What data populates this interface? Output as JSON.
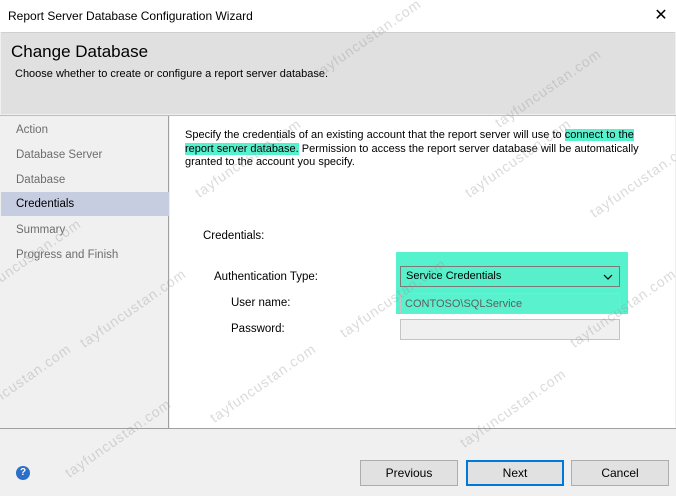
{
  "window": {
    "title": "Report Server Database Configuration Wizard",
    "close_glyph": "✕"
  },
  "header": {
    "title": "Change Database",
    "subtitle": "Choose whether to create or configure a report server database."
  },
  "sidebar": {
    "items": [
      {
        "label": "Action"
      },
      {
        "label": "Database Server"
      },
      {
        "label": "Database"
      },
      {
        "label": "Credentials"
      },
      {
        "label": "Summary"
      },
      {
        "label": "Progress and Finish"
      }
    ],
    "selected": "Credentials"
  },
  "content": {
    "description_part1": "Specify the credentials of an existing account that the report server will use to ",
    "description_highlight": "connect to the report server database.",
    "description_part2": " Permission to access the report server database will be automatically granted to the account you specify.",
    "credentials_label": "Credentials:",
    "auth_type_label": "Authentication Type:",
    "auth_type_value": "Service Credentials",
    "username_label": "User name:",
    "username_value": "CONTOSO\\SQLService",
    "password_label": "Password:",
    "password_value": ""
  },
  "footer": {
    "help_glyph": "?",
    "previous_label": "Previous",
    "next_label": "Next",
    "cancel_label": "Cancel"
  },
  "watermark": {
    "text": "tayfuncustan.com"
  },
  "colors": {
    "highlight": "#55f2cd",
    "selection": "#c6cde0",
    "header_bg": "#e0e0e0",
    "accent": "#0078d7"
  }
}
